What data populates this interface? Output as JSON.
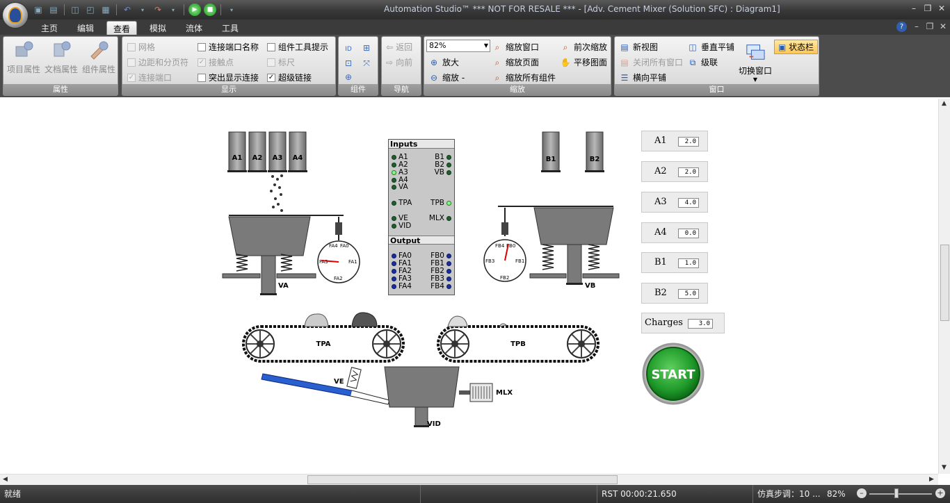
{
  "window": {
    "title": "Automation Studio™   *** NOT FOR RESALE ***   - [Adv. Cement Mixer (Solution SFC) : Diagram1]"
  },
  "tabs": [
    "主页",
    "编辑",
    "查看",
    "模拟",
    "流体",
    "工具"
  ],
  "active_tab": "查看",
  "ribbon": {
    "properties": {
      "label": "属性",
      "buttons": [
        "项目属性",
        "文档属性",
        "组件属性"
      ]
    },
    "display": {
      "label": "显示",
      "col1": [
        {
          "label": "网格",
          "checked": false,
          "disabled": true
        },
        {
          "label": "边距和分页符",
          "checked": false,
          "disabled": true
        },
        {
          "label": "连接端口",
          "checked": true,
          "disabled": true
        }
      ],
      "col2": [
        {
          "label": "连接端口名称",
          "checked": false,
          "disabled": false
        },
        {
          "label": "接触点",
          "checked": true,
          "disabled": true
        },
        {
          "label": "突出显示连接",
          "checked": false,
          "disabled": false
        }
      ],
      "col3": [
        {
          "label": "组件工具提示",
          "checked": false,
          "disabled": false
        },
        {
          "label": "标尺",
          "checked": false,
          "disabled": true
        },
        {
          "label": "超级链接",
          "checked": true,
          "disabled": false
        }
      ]
    },
    "components": {
      "label": "组件"
    },
    "navigation": {
      "label": "导航",
      "back": "返回",
      "forward": "向前"
    },
    "zoom": {
      "label": "缩放",
      "value": "82%",
      "zoom_in": "放大",
      "zoom_out": "缩放 -",
      "zoom_window": "缩放窗口",
      "zoom_page": "缩放页面",
      "zoom_all": "缩放所有组件",
      "prev_zoom": "前次缩放",
      "pan": "平移图面"
    },
    "window": {
      "label": "窗口",
      "new_view": "新视图",
      "close_all": "关闭所有窗口",
      "tile_h": "横向平铺",
      "tile_v": "垂直平铺",
      "cascade": "级联",
      "switch": "切换窗口",
      "statusbar": "状态栏"
    }
  },
  "diagram": {
    "silos_a": [
      "A1",
      "A2",
      "A3",
      "A4"
    ],
    "silos_b": [
      "B1",
      "B2"
    ],
    "io": {
      "inputs_title": "Inputs",
      "outputs_title": "Output",
      "inputs_left": [
        "A1",
        "A2",
        "A3",
        "A4",
        "VA",
        "TPA",
        "VE",
        "VID"
      ],
      "inputs_right": [
        "B1",
        "B2",
        "VB",
        "TPB",
        "MLX"
      ],
      "outputs_left": [
        "FA0",
        "FA1",
        "FA2",
        "FA3",
        "FA4"
      ],
      "outputs_right": [
        "FB0",
        "FB1",
        "FB2",
        "FB3",
        "FB4"
      ]
    },
    "labels": {
      "va": "VA",
      "vb": "VB",
      "tpa": "TPA",
      "tpb": "TPB",
      "ve": "VE",
      "mlx": "MLX",
      "vid": "VID",
      "gauge_a": [
        "FA4",
        "FA0",
        "FA3",
        "FA1",
        "FA2"
      ],
      "gauge_b": [
        "FB4",
        "FB0",
        "FB3",
        "FB1",
        "FB2"
      ]
    },
    "variables": [
      {
        "name": "A1",
        "value": "2.0"
      },
      {
        "name": "A2",
        "value": "2.0"
      },
      {
        "name": "A3",
        "value": "4.0"
      },
      {
        "name": "A4",
        "value": "0.0"
      },
      {
        "name": "B1",
        "value": "1.0"
      },
      {
        "name": "B2",
        "value": "5.0"
      }
    ],
    "charges": {
      "name": "Charges",
      "value": "3.0"
    },
    "start_label": "START"
  },
  "statusbar": {
    "ready": "就绪",
    "rst": "RST 00:00:21.650",
    "sim_step": "仿真步调：10 ...",
    "zoom": "82%"
  }
}
